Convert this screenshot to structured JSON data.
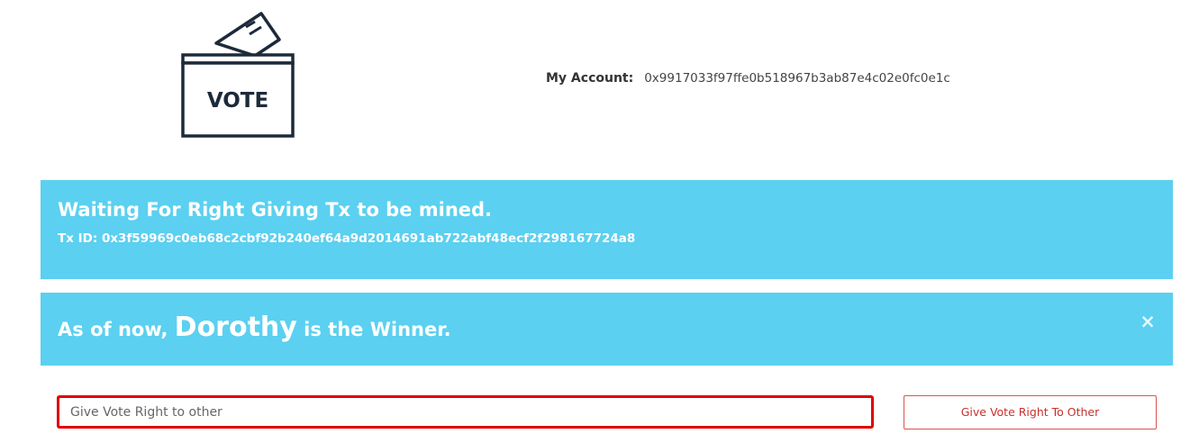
{
  "logo": {
    "text": "VOTE",
    "icon": "ballot-box-icon"
  },
  "account": {
    "label": "My Account:",
    "address": "0x9917033f97ffe0b518967b3ab87e4c02e0fc0e1c"
  },
  "tx_banner": {
    "title": "Waiting For Right Giving Tx to be mined.",
    "tx_id_text": "Tx ID: 0x3f59969c0eb68c2cbf92b240ef64a9d2014691ab722abf48ecf2f298167724a8"
  },
  "winner_banner": {
    "prefix": "As of now,",
    "winner": "Dorothy",
    "suffix": "is the Winner.",
    "close_glyph": "×"
  },
  "give_right": {
    "input_value": "",
    "input_placeholder": "Give Vote Right to other",
    "button_label": "Give Vote Right To Other"
  },
  "colors": {
    "banner_bg": "#5bd0f0",
    "input_border": "#e00000",
    "button_border": "#d9534f",
    "button_text": "#c9302c",
    "logo_stroke": "#1d2a3a"
  }
}
